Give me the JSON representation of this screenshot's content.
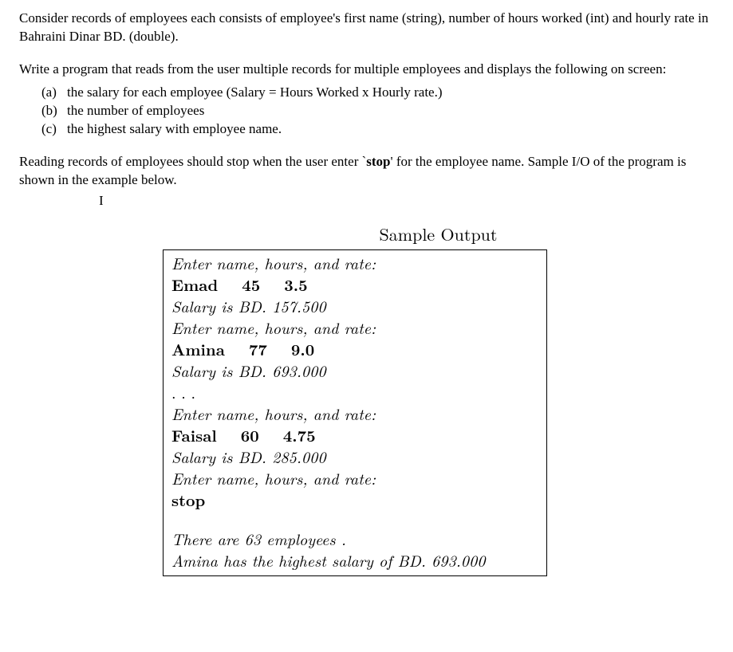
{
  "para1": "Consider records of employees each consists of employee's first name (string), number of hours worked (int) and hourly rate in Bahraini Dinar BD. (double).",
  "para2": "Write a program that reads from the user multiple records for multiple employees and displays the following on screen:",
  "list": {
    "a": {
      "label": "(a)",
      "text": "the salary for each employee (Salary = Hours Worked  x Hourly rate.)"
    },
    "b": {
      "label": "(b)",
      "text": "the number of employees"
    },
    "c": {
      "label": "(c)",
      "text": "the highest salary with employee name."
    }
  },
  "para3_a": "Reading records of employees should stop when the user enter `",
  "para3_stop": "stop",
  "para3_b": "' for the employee name. Sample I/O of the program is shown in the example below.",
  "text_cursor": "I",
  "sample": {
    "title": "Sample Output",
    "prompt": "Enter name, hours, and rate:",
    "salary_prefix": "Salary is BD. ",
    "records": [
      {
        "name": "Emad",
        "hours": "45",
        "rate": "3.5",
        "salary": "157.500"
      },
      {
        "name": "Amina",
        "hours": "77",
        "rate": "9.0",
        "salary": "693.000"
      },
      {
        "name": "Faisal",
        "hours": "60",
        "rate": "4.75",
        "salary": "285.000"
      }
    ],
    "ellipsis": ". . .",
    "stop": "stop",
    "summary_count_a": "There are ",
    "summary_count_n": "63",
    "summary_count_b": " employees .",
    "summary_high_name": "Amina",
    "summary_high_mid": " has the highest salary of BD. ",
    "summary_high_val": "693.000"
  }
}
